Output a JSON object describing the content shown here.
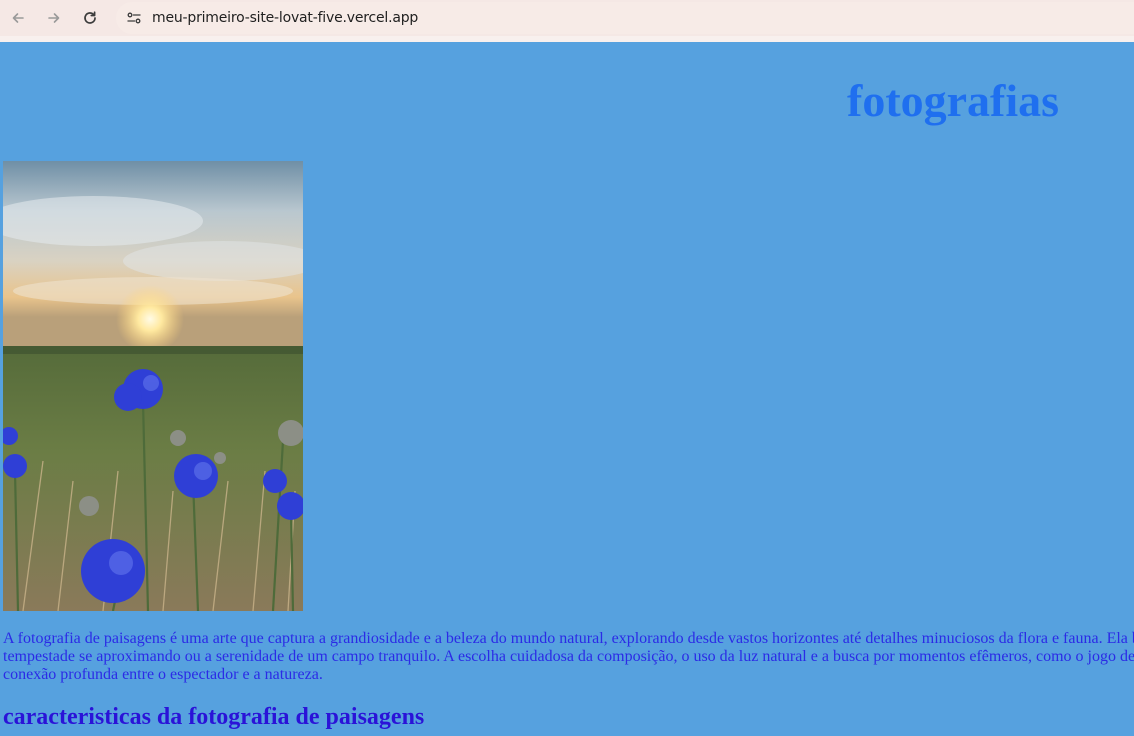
{
  "browser": {
    "url": "meu-primeiro-site-lovat-five.vercel.app",
    "icons": [
      "back-arrow-icon",
      "forward-arrow-icon",
      "reload-icon",
      "site-settings-icon"
    ]
  },
  "page": {
    "title": "fotografias",
    "photo_alt": "blue cornflowers in a field at sunset",
    "intro_lines": [
      "A fotografia de paisagens é uma arte que captura a grandiosidade e a beleza do mundo natural, explorando desde vastos horizontes até detalhes minuciosos da flora e fauna. Ela b",
      "tempestade se aproximando ou a serenidade de um campo tranquilo. A escolha cuidadosa da composição, o uso da luz natural e a busca por momentos efêmeros, como o jogo de",
      "conexão profunda entre o espectador e a natureza."
    ],
    "section_heading": "caracteristicas da fotografia de paisagens"
  },
  "colors": {
    "page_background": "#56a1df",
    "title": "#1f6fef",
    "body_text": "#2b2be6",
    "heading": "#2a13d8",
    "browser_bar": "#f5e8e5"
  }
}
